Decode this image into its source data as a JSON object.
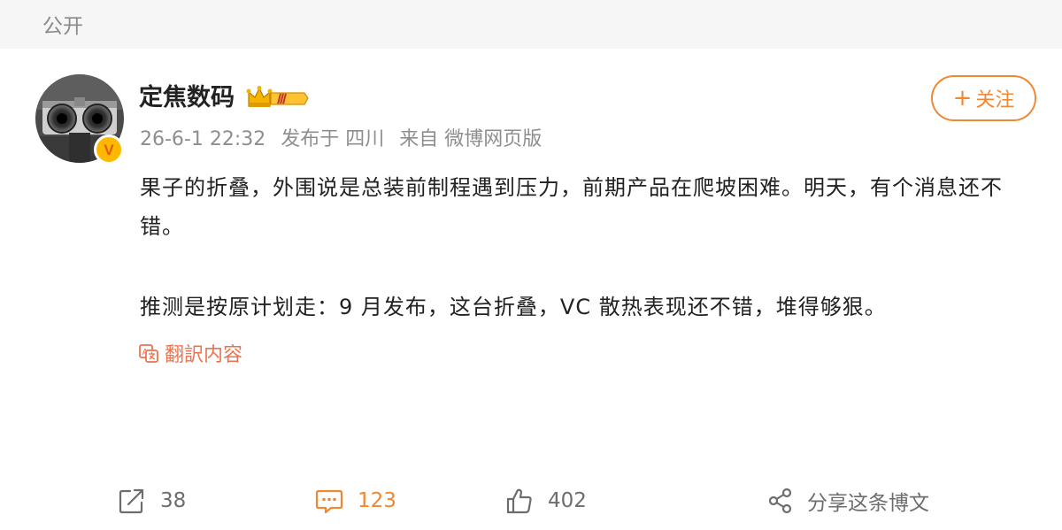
{
  "header": {
    "visibility": "公开"
  },
  "author": {
    "name": "定焦数码",
    "vip_level": "Ⅲ",
    "verified_mark": "V"
  },
  "follow_button": {
    "label": "关注"
  },
  "meta": {
    "time": "26-6-1 22:32",
    "location": "发布于 四川",
    "source": "来自 微博网页版"
  },
  "post": {
    "paragraphs": [
      "果子的折叠，外围说是总装前制程遇到压力，前期产品在爬坡困难。明天，有个消息还不错。",
      "推测是按原计划走：9 月发布，这台折叠，VC 散热表现还不错，堆得够狠。"
    ],
    "translate_label": "翻訳内容"
  },
  "actions": {
    "repost": {
      "count": "38"
    },
    "comment": {
      "count": "123"
    },
    "like": {
      "count": "402"
    },
    "share": {
      "label": "分享这条博文"
    }
  },
  "colors": {
    "accent": "#f08732",
    "translate": "#eb7350",
    "muted": "#8e8e8e",
    "vip_gold": "#ffb800"
  },
  "icons": [
    "repost-icon",
    "comment-icon",
    "like-icon",
    "share-icon",
    "translate-icon",
    "crown-icon"
  ]
}
